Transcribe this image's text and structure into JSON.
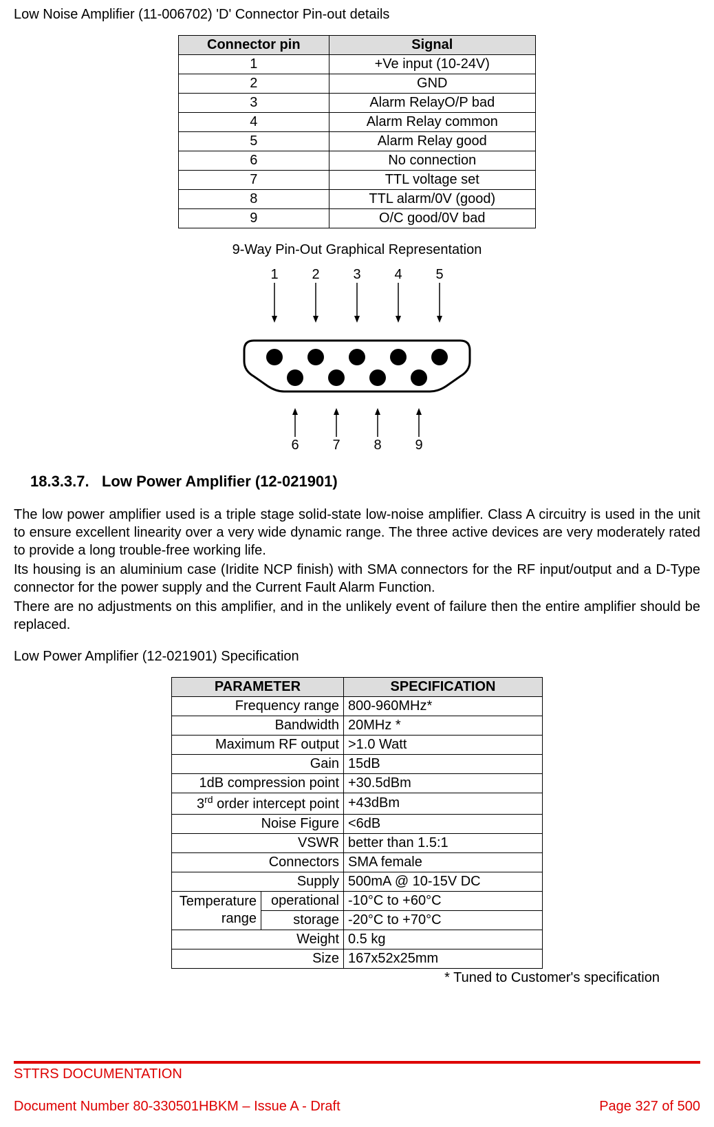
{
  "title_line": "Low Noise Amplifier (11-006702) 'D' Connector Pin-out details",
  "pinout_table": {
    "headers": {
      "col1": "Connector pin",
      "col2": "Signal"
    },
    "rows": [
      {
        "pin": "1",
        "signal": "+Ve input (10-24V)"
      },
      {
        "pin": "2",
        "signal": "GND"
      },
      {
        "pin": "3",
        "signal": "Alarm RelayO/P bad"
      },
      {
        "pin": "4",
        "signal": "Alarm Relay common"
      },
      {
        "pin": "5",
        "signal": "Alarm Relay good"
      },
      {
        "pin": "6",
        "signal": "No connection"
      },
      {
        "pin": "7",
        "signal": "TTL voltage set"
      },
      {
        "pin": "8",
        "signal": "TTL alarm/0V (good)"
      },
      {
        "pin": "9",
        "signal": "O/C good/0V bad"
      }
    ]
  },
  "diagram_title": "9-Way Pin-Out Graphical Representation",
  "diagram_labels_top": [
    "1",
    "2",
    "3",
    "4",
    "5"
  ],
  "diagram_labels_bottom": [
    "6",
    "7",
    "8",
    "9"
  ],
  "section_heading_number": "18.3.3.7.",
  "section_heading_text": "Low Power Amplifier (12-021901)",
  "paragraphs": [
    "The low power amplifier used is a triple stage solid-state low-noise amplifier. Class A circuitry is used in the unit to ensure excellent linearity over a very wide dynamic range. The three active devices are very moderately rated to provide a long trouble-free working life.",
    "Its housing is an aluminium case (Iridite NCP finish) with SMA connectors for the RF input/output and a D-Type connector for the power supply and the Current Fault Alarm Function.",
    "There are no adjustments on this amplifier, and in the unlikely event of failure then the entire amplifier should be replaced."
  ],
  "spec_title": "Low Power Amplifier (12-021901) Specification",
  "spec_table": {
    "headers": {
      "col1": "PARAMETER",
      "col2": "SPECIFICATION"
    },
    "rows": [
      {
        "param": "Frequency range",
        "spec": "800-960MHz*"
      },
      {
        "param": "Bandwidth",
        "spec": "20MHz *"
      },
      {
        "param": "Maximum RF output",
        "spec": ">1.0 Watt"
      },
      {
        "param": "Gain",
        "spec": "15dB"
      },
      {
        "param": "1dB compression point",
        "spec": "+30.5dBm"
      },
      {
        "param_html": "3<sup>rd</sup> order intercept point",
        "spec": "+43dBm"
      },
      {
        "param": "Noise Figure",
        "spec": "<6dB"
      },
      {
        "param": "VSWR",
        "spec": "better than 1.5:1"
      },
      {
        "param": "Connectors",
        "spec": "SMA female"
      },
      {
        "param": "Supply",
        "spec": "500mA @ 10-15V DC"
      }
    ],
    "temp_label": "Temperature range",
    "temp_op_label": "operational",
    "temp_op_spec": "-10°C to +60°C",
    "temp_st_label": "storage",
    "temp_st_spec": "-20°C to +70°C",
    "rows_after": [
      {
        "param": "Weight",
        "spec": "0.5 kg"
      },
      {
        "param": "Size",
        "spec": "167x52x25mm"
      }
    ]
  },
  "tuned_note": "* Tuned to Customer's specification",
  "footer": {
    "top": "STTRS DOCUMENTATION",
    "doc": "Document Number 80-330501HBKM – Issue A - Draft",
    "page": "Page 327 of 500"
  }
}
